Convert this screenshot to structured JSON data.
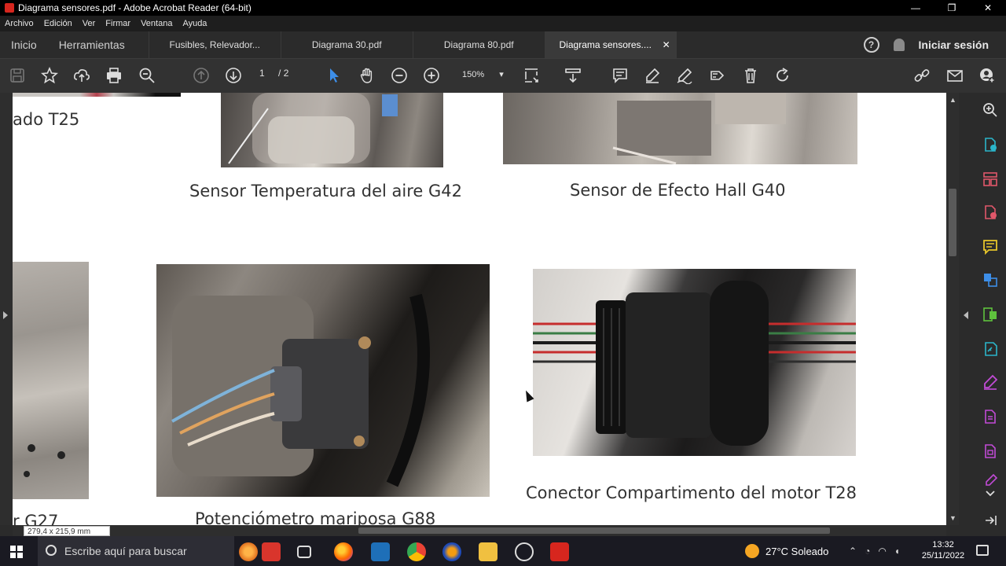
{
  "window": {
    "title": "Diagrama sensores.pdf - Adobe Acrobat Reader (64-bit)",
    "minimize_glyph": "—",
    "maximize_glyph": "❐",
    "close_glyph": "✕"
  },
  "menu": [
    "Archivo",
    "Edición",
    "Ver",
    "Firmar",
    "Ventana",
    "Ayuda"
  ],
  "nav_tabs": [
    "Inicio",
    "Herramientas"
  ],
  "doc_tabs": [
    {
      "label": "Fusibles, Relevador..."
    },
    {
      "label": "Diagrama 30.pdf"
    },
    {
      "label": "Diagrama 80.pdf"
    },
    {
      "label": "Diagrama sensores....",
      "close": "✕"
    }
  ],
  "header_right": {
    "help": "?",
    "signin": "Iniciar sesión"
  },
  "toolbar": {
    "page_current": "1",
    "page_total": "/  2",
    "zoom": "150%",
    "zoom_caret": "▾"
  },
  "document": {
    "captions": [
      "ado T25",
      "Sensor Temperatura del aire G42",
      "Sensor de Efecto Hall G40",
      "Conector  Compartimento del motor T28",
      "Potenciómetro mariposa G88",
      "r G27"
    ],
    "page_size": "279,4 x 215,9 mm"
  },
  "taskbar": {
    "search_placeholder": "Escribe aquí para buscar",
    "weather": "27°C  Soleado",
    "time": "13:32",
    "date": "25/11/2022"
  },
  "colors": {
    "accent_purple": "#c14bd6",
    "accent_green": "#5fc23d",
    "accent_teal": "#2bb5c9",
    "accent_yellow": "#e8c62a",
    "accent_blue": "#3d8ee8",
    "adobe_red": "#d7261e"
  }
}
